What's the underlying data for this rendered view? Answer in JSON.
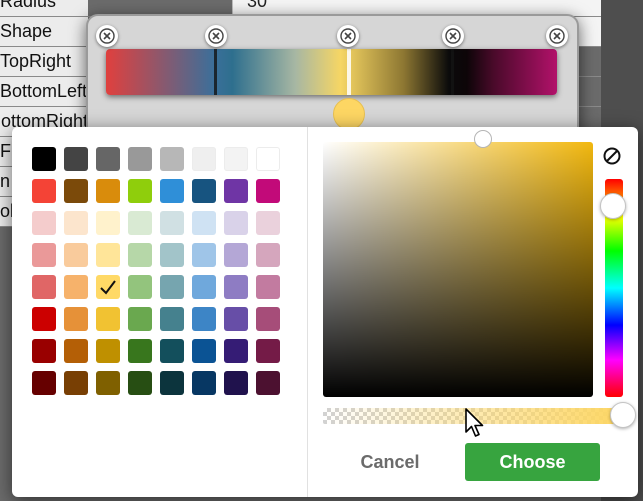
{
  "property_rows": [
    {
      "label": "Radius",
      "value": "30"
    },
    {
      "label": "Shape",
      "value": ""
    },
    {
      "label": "TopRight",
      "value": ""
    },
    {
      "label": "BottomLeft",
      "value": ""
    },
    {
      "label": "BottomRight",
      "value": ""
    },
    {
      "label": "Fro",
      "value": ""
    },
    {
      "label": "n",
      "value": ""
    },
    {
      "label": "ole",
      "value": ""
    }
  ],
  "gradient_editor": {
    "stops": [
      "#e0403e",
      "#2e6f8e",
      "#f6d664",
      "#0d0508",
      "#b2116a"
    ],
    "selected_stop_color": "#fdd663",
    "remove_icon": "close-icon"
  },
  "color_picker": {
    "palette": [
      [
        "#000000",
        "#444444",
        "#666666",
        "#999999",
        "#b7b7b7",
        "#efefef",
        "#f3f3f3",
        "#ffffff"
      ],
      [
        "#f44336",
        "#7b4a0a",
        "#d98c0c",
        "#8fce0c",
        "#2f8fd8",
        "#175480",
        "#6f35a5",
        "#c20a79"
      ],
      [
        "#f4cccc",
        "#fce5cd",
        "#fff2cc",
        "#d9ead3",
        "#d0e0e3",
        "#cfe2f3",
        "#d9d2e9",
        "#ead1dc"
      ],
      [
        "#ea9999",
        "#f9cb9c",
        "#ffe599",
        "#b6d7a8",
        "#a2c4c9",
        "#9fc5e8",
        "#b4a7d6",
        "#d5a6bd"
      ],
      [
        "#e06666",
        "#f6b26b",
        "#ffd966",
        "#93c47d",
        "#76a5af",
        "#6fa8dc",
        "#8e7cc3",
        "#c27ba0"
      ],
      [
        "#cc0000",
        "#e69138",
        "#f1c232",
        "#6aa84f",
        "#45818e",
        "#3d85c6",
        "#674ea7",
        "#a64d79"
      ],
      [
        "#990000",
        "#b45f06",
        "#bf9000",
        "#38761d",
        "#134f5c",
        "#0b5394",
        "#351c75",
        "#741b47"
      ],
      [
        "#660000",
        "#783f04",
        "#7f6000",
        "#274e13",
        "#0c343d",
        "#073763",
        "#20124d",
        "#4c1130"
      ]
    ],
    "selected_swatch": "#ffd966",
    "base_hue_color": "#f2b80f",
    "no_color_icon": "no-color-icon",
    "cancel_label": "Cancel",
    "choose_label": "Choose",
    "choose_color": "#37a43f"
  }
}
